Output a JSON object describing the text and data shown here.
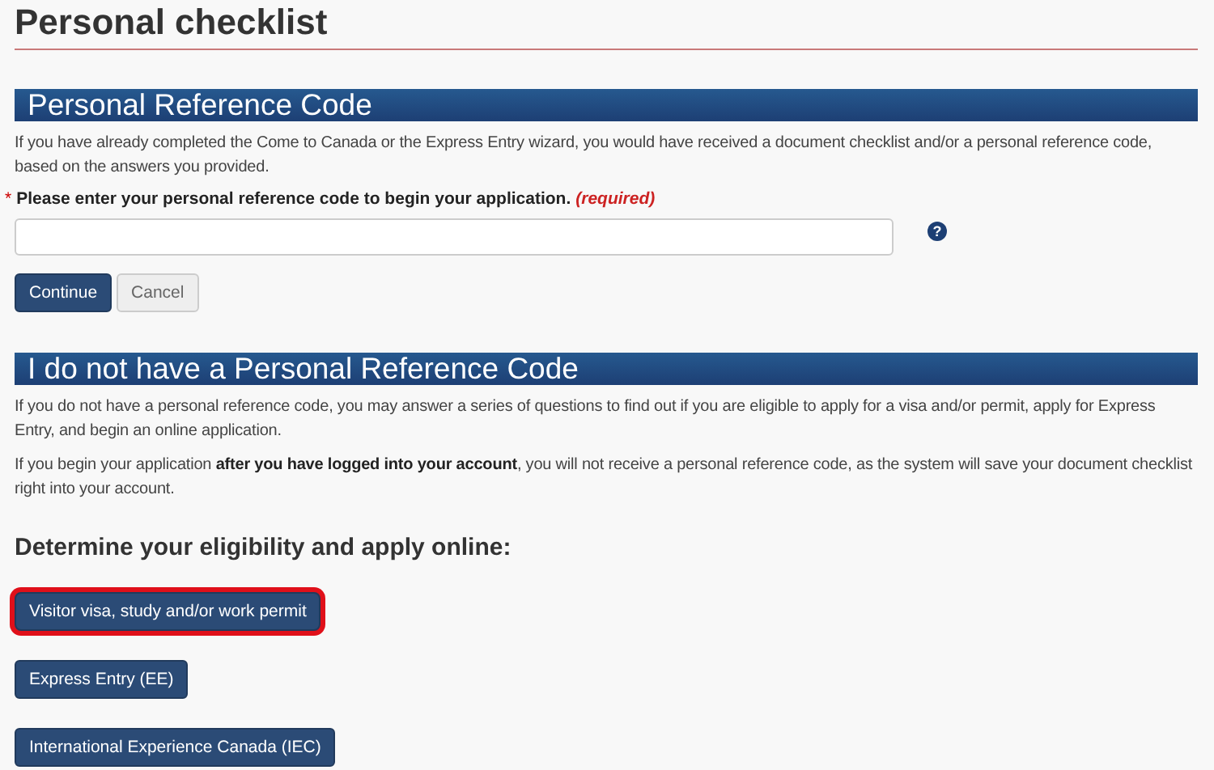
{
  "title": "Personal checklist",
  "code_section": {
    "heading": "Personal Reference Code",
    "intro": "If you have already completed the Come to Canada or the Express Entry wizard, you would have received a document checklist and/or a personal reference code, based on the answers you provided.",
    "required_mark": "*",
    "label": "Please enter your personal reference code to begin your application.",
    "required_note": "(required)",
    "help_icon": "?",
    "buttons": [
      {
        "label": "Continue",
        "kind": "primary"
      },
      {
        "label": "Cancel",
        "kind": "secondary"
      }
    ]
  },
  "no_code_section": {
    "heading": "I do not have a Personal Reference Code",
    "paragraphs": [
      "If you do not have a personal reference code, you may answer a series of questions to find out if you are eligible to apply for a visa and/or permit, apply for Express Entry, and begin an online application.",
      "If you begin your application **after you have logged into your account**, you will not receive a personal reference code, as the system will save your document checklist right into your account."
    ],
    "subheading": "Determine your eligibility and apply online:",
    "options": [
      {
        "label": "Visitor visa, study and/or work permit",
        "highlighted": true
      },
      {
        "label": "Express Entry (EE)",
        "highlighted": false
      },
      {
        "label": "International Experience Canada (IEC)",
        "highlighted": false
      }
    ]
  }
}
